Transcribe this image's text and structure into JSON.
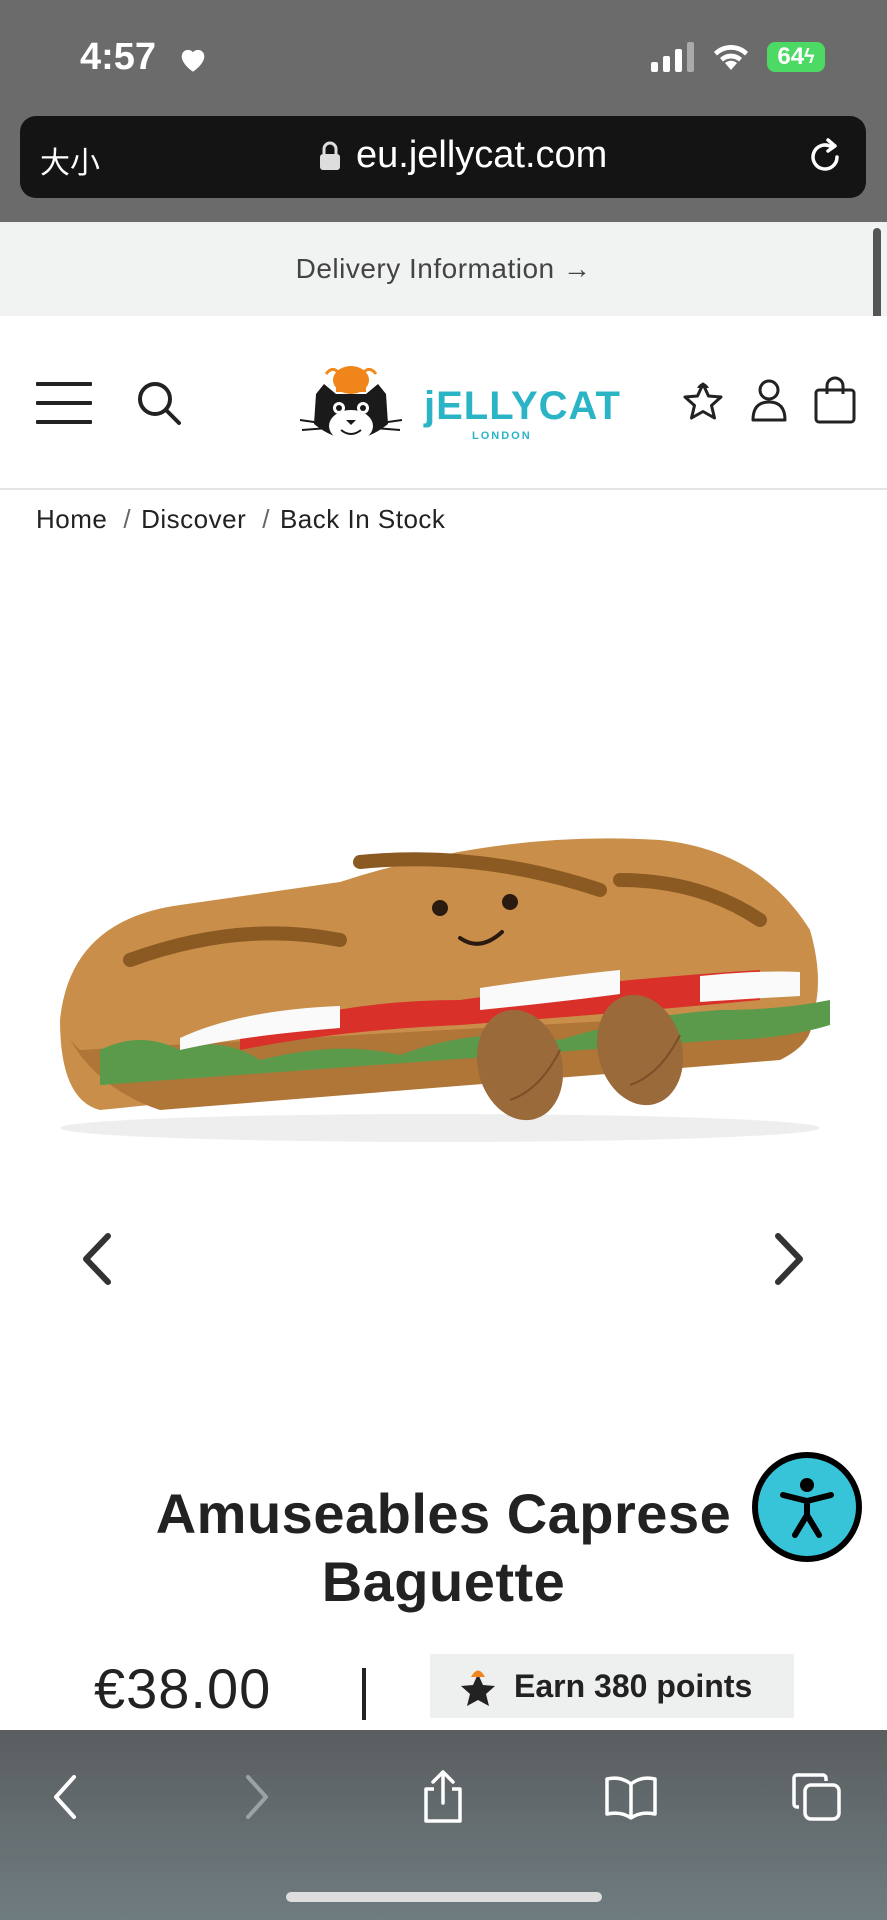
{
  "status_bar": {
    "time": "4:57",
    "battery": "64"
  },
  "browser": {
    "text_size_label": "大小",
    "url": "eu.jellycat.com"
  },
  "delivery_bar": {
    "label": "Delivery Information →"
  },
  "header": {
    "logo_text": "jELLYCAT",
    "logo_subtext": "LONDON",
    "icons": [
      "menu-icon",
      "search-icon",
      "rewards-star-icon",
      "account-icon",
      "bag-icon"
    ]
  },
  "breadcrumb": {
    "items": [
      "Home",
      "Discover",
      "Back In Stock"
    ],
    "separator": "/"
  },
  "product": {
    "title_line1": "Amuseables Caprese",
    "title_line2": "Baguette",
    "price": "€38.00",
    "points_label": "Earn 380 points"
  },
  "colors": {
    "brand_teal": "#2ab4c6",
    "accessibility_button": "#38c4d8",
    "chrome_gray": "#6b6b6b",
    "delivery_bg": "#f1f2f2"
  }
}
